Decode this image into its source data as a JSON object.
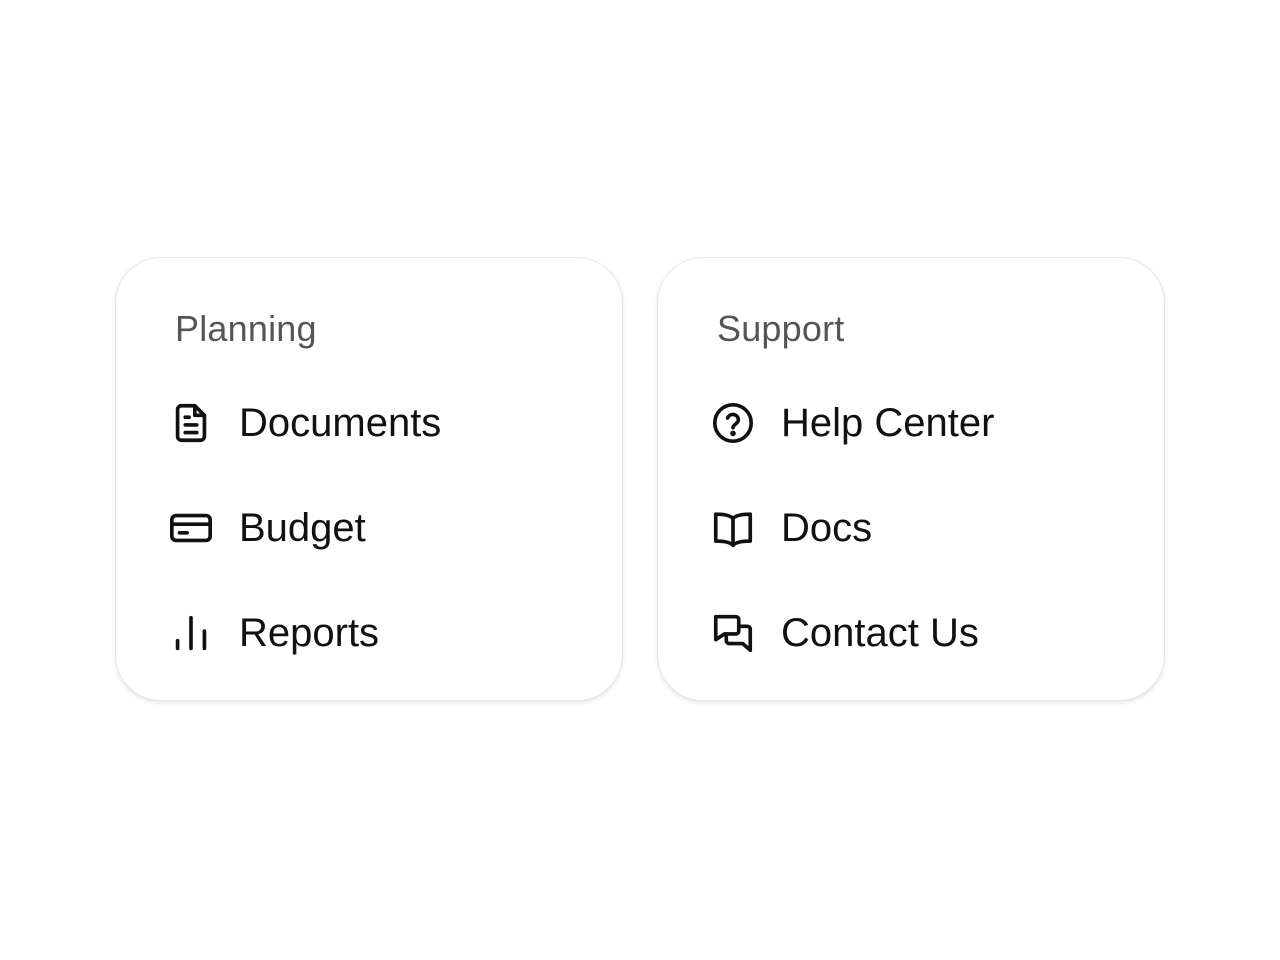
{
  "cards": [
    {
      "title": "Planning",
      "items": [
        {
          "label": "Documents",
          "icon": "document-icon"
        },
        {
          "label": "Budget",
          "icon": "credit-card-icon"
        },
        {
          "label": "Reports",
          "icon": "bar-chart-icon"
        }
      ]
    },
    {
      "title": "Support",
      "items": [
        {
          "label": "Help Center",
          "icon": "help-circle-icon"
        },
        {
          "label": "Docs",
          "icon": "book-open-icon"
        },
        {
          "label": "Contact Us",
          "icon": "chat-bubbles-icon"
        }
      ]
    }
  ],
  "colors": {
    "background": "#ffffff",
    "card_border": "#e6e6e6",
    "heading_text": "#555555",
    "item_text": "#111111"
  }
}
